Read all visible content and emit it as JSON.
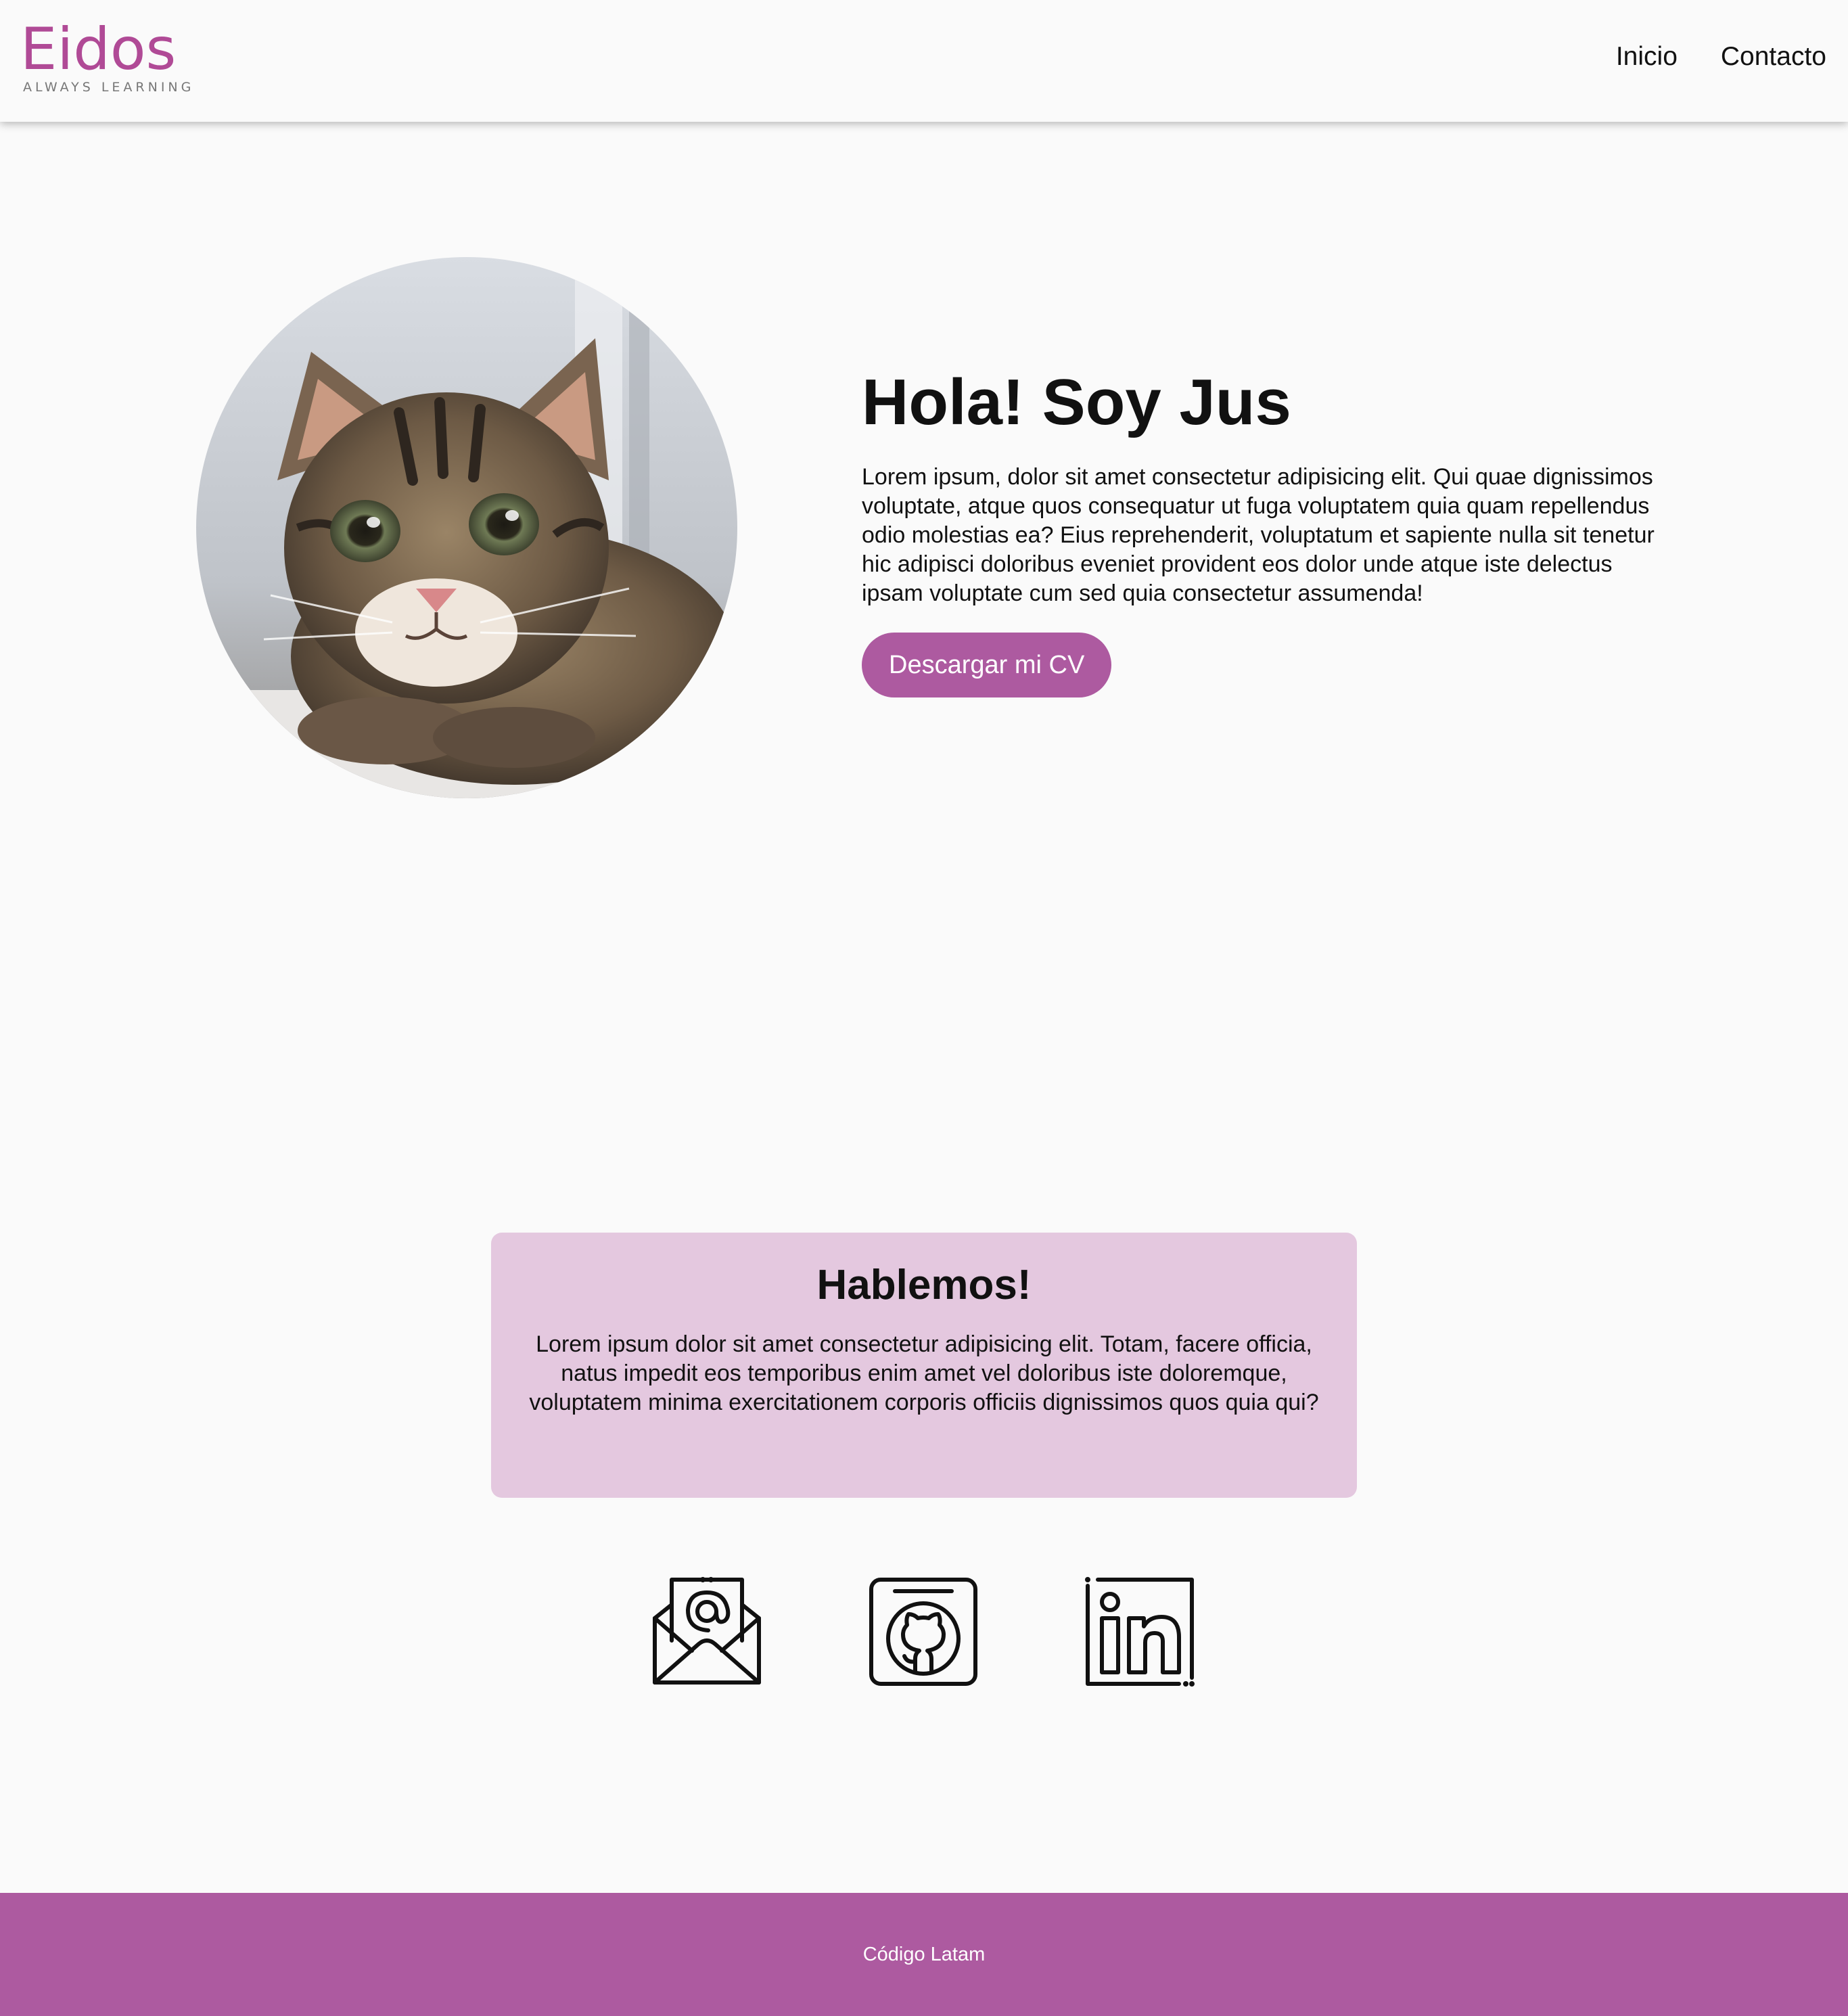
{
  "brand": {
    "logo_text": "Eidos",
    "tagline": "ALWAYS LEARNING",
    "color": "#b04a96"
  },
  "nav": {
    "items": [
      {
        "label": "Inicio"
      },
      {
        "label": "Contacto"
      }
    ]
  },
  "hero": {
    "image_icon": "kitten-photo",
    "title": "Hola! Soy Jus",
    "body": "Lorem ipsum, dolor sit amet consectetur adipisicing elit. Qui quae dignissimos voluptate, atque quos consequatur ut fuga voluptatem quia quam repellendus odio molestias ea? Eius reprehenderit, voluptatum et sapiente nulla sit tenetur hic adipisci doloribus eveniet provident eos dolor unde atque iste delectus ipsam voluptate cum sed quia consectetur assumenda!",
    "button_label": "Descargar mi CV"
  },
  "contact": {
    "title": "Hablemos!",
    "body": "Lorem ipsum dolor sit amet consectetur adipisicing elit. Totam, facere officia, natus impedit eos temporibus enim amet vel doloribus iste doloremque, voluptatem minima exercitationem corporis officiis dignissimos quos quia qui?",
    "icons": [
      "email-icon",
      "github-icon",
      "linkedin-icon"
    ]
  },
  "footer": {
    "text": "Código Latam"
  },
  "colors": {
    "accent": "#ad5aa0",
    "card_bg": "#e4c8df",
    "page_bg": "#fafafa",
    "text": "#111111"
  }
}
